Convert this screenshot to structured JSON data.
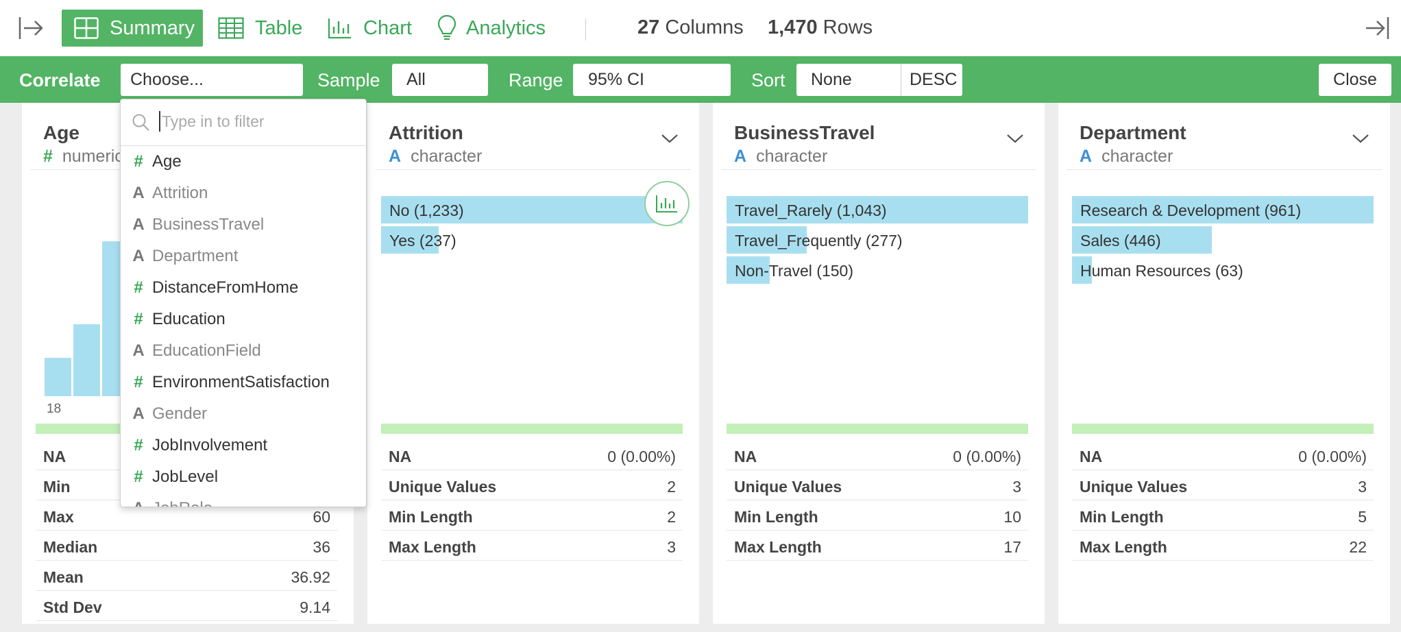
{
  "toolbar": {
    "tabs": [
      {
        "label": "Summary",
        "icon": "grid-icon",
        "active": true
      },
      {
        "label": "Table",
        "icon": "table-icon",
        "active": false
      },
      {
        "label": "Chart",
        "icon": "bar-chart-icon",
        "active": false
      },
      {
        "label": "Analytics",
        "icon": "lightbulb-icon",
        "active": false
      }
    ],
    "columns_count": "27",
    "columns_label": "Columns",
    "rows_count": "1,470",
    "rows_label": "Rows"
  },
  "correlate_bar": {
    "correlate_label": "Correlate",
    "correlate_value": "Choose...",
    "sample_label": "Sample",
    "sample_value": "All",
    "range_label": "Range",
    "range_value": "95% CI",
    "sort_label": "Sort",
    "sort_value": "None",
    "sort_order": "DESC",
    "close_label": "Close"
  },
  "dropdown": {
    "placeholder": "Type in to filter",
    "items": [
      {
        "label": "Age",
        "type": "numeric"
      },
      {
        "label": "Attrition",
        "type": "character"
      },
      {
        "label": "BusinessTravel",
        "type": "character"
      },
      {
        "label": "Department",
        "type": "character"
      },
      {
        "label": "DistanceFromHome",
        "type": "numeric"
      },
      {
        "label": "Education",
        "type": "numeric"
      },
      {
        "label": "EducationField",
        "type": "character"
      },
      {
        "label": "EnvironmentSatisfaction",
        "type": "numeric"
      },
      {
        "label": "Gender",
        "type": "character"
      },
      {
        "label": "JobInvolvement",
        "type": "numeric"
      },
      {
        "label": "JobLevel",
        "type": "numeric"
      },
      {
        "label": "JobRole",
        "type": "character"
      }
    ]
  },
  "cards": {
    "age": {
      "title": "Age",
      "type_glyph": "#",
      "type_label": "numeric",
      "hist_min_label": "18",
      "stats": [
        {
          "key": "NA",
          "value": ""
        },
        {
          "key": "Min",
          "value": ""
        },
        {
          "key": "Max",
          "value": "60"
        },
        {
          "key": "Median",
          "value": "36"
        },
        {
          "key": "Mean",
          "value": "36.92"
        },
        {
          "key": "Std Dev",
          "value": "9.14"
        }
      ]
    },
    "attrition": {
      "title": "Attrition",
      "type_glyph": "A",
      "type_label": "character",
      "bars": [
        {
          "label": "No (1,233)",
          "fraction": 1.0
        },
        {
          "label": "Yes (237)",
          "fraction": 0.19
        }
      ],
      "stats": [
        {
          "key": "NA",
          "value": "0 (0.00%)"
        },
        {
          "key": "Unique Values",
          "value": "2"
        },
        {
          "key": "Min Length",
          "value": "2"
        },
        {
          "key": "Max Length",
          "value": "3"
        }
      ]
    },
    "business_travel": {
      "title": "BusinessTravel",
      "type_glyph": "A",
      "type_label": "character",
      "bars": [
        {
          "label": "Travel_Rarely (1,043)",
          "fraction": 1.0
        },
        {
          "label": "Travel_Frequently (277)",
          "fraction": 0.266
        },
        {
          "label": "Non-Travel (150)",
          "fraction": 0.144
        }
      ],
      "stats": [
        {
          "key": "NA",
          "value": "0 (0.00%)"
        },
        {
          "key": "Unique Values",
          "value": "3"
        },
        {
          "key": "Min Length",
          "value": "10"
        },
        {
          "key": "Max Length",
          "value": "17"
        }
      ]
    },
    "department": {
      "title": "Department",
      "type_glyph": "A",
      "type_label": "character",
      "bars": [
        {
          "label": "Research & Development (961)",
          "fraction": 1.0
        },
        {
          "label": "Sales (446)",
          "fraction": 0.464
        },
        {
          "label": "Human Resources (63)",
          "fraction": 0.066
        }
      ],
      "stats": [
        {
          "key": "NA",
          "value": "0 (0.00%)"
        },
        {
          "key": "Unique Values",
          "value": "3"
        },
        {
          "key": "Min Length",
          "value": "5"
        },
        {
          "key": "Max Length",
          "value": "22"
        }
      ]
    }
  }
}
